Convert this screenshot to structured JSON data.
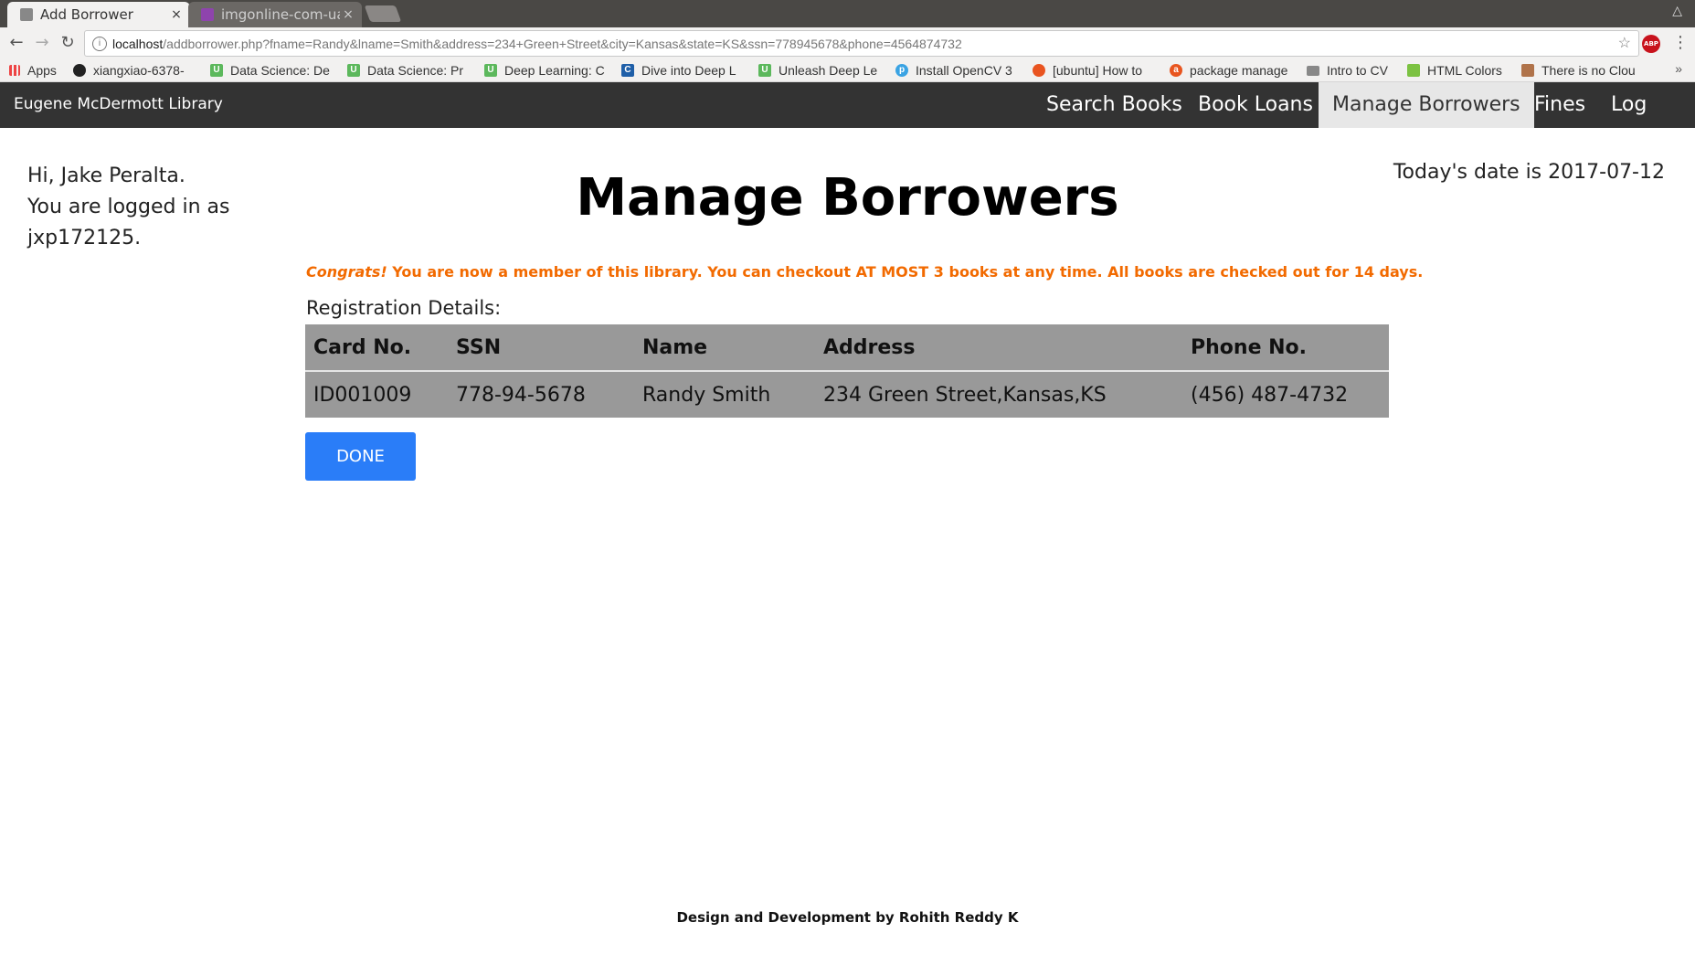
{
  "browser": {
    "tabs": [
      {
        "title": "Add Borrower",
        "close": "×"
      },
      {
        "title": "imgonline-com-ua-",
        "close": "×"
      }
    ],
    "url_host": "localhost",
    "url_path": "/addborrower.php?fname=Randy&lname=Smith&address=234+Green+Street&city=Kansas&state=KS&ssn=778945678&phone=4564874732",
    "bookmarks": [
      {
        "label": "Apps",
        "icon": "apps-grid-icon"
      },
      {
        "label": "xiangxiao-6378-",
        "icon": "github-icon"
      },
      {
        "label": "Data Science: De",
        "icon": "udemy-icon"
      },
      {
        "label": "Data Science: Pr",
        "icon": "udemy-icon"
      },
      {
        "label": "Deep Learning: C",
        "icon": "udemy-icon"
      },
      {
        "label": "Dive into Deep L",
        "icon": "page-icon"
      },
      {
        "label": "Unleash Deep Le",
        "icon": "udemy-icon"
      },
      {
        "label": "Install OpenCV 3",
        "icon": "p-icon"
      },
      {
        "label": "[ubuntu] How to",
        "icon": "ubuntu-icon"
      },
      {
        "label": "package manage",
        "icon": "ask-icon"
      },
      {
        "label": "Intro to CV",
        "icon": "folder-icon"
      },
      {
        "label": "HTML Colors",
        "icon": "colors-icon"
      },
      {
        "label": "There is no Clou",
        "icon": "cloud-icon"
      }
    ],
    "abp_label": "ABP"
  },
  "navbar": {
    "brand": "Eugene McDermott Library",
    "items": [
      "Search Books",
      "Book Loans",
      "Manage Borrowers",
      "Fines",
      "Log out"
    ],
    "active": "Manage Borrowers"
  },
  "greeting": {
    "line1": "Hi, Jake Peralta.",
    "line2": "You are logged in as",
    "line3": "jxp172125."
  },
  "date_text": "Today's date is 2017-07-12",
  "page_title": "Manage Borrowers",
  "notice": {
    "emphasis": "Congrats!",
    "text": " You are now a member of this library. You can checkout AT MOST 3 books at any time. All books are checked out for 14 days."
  },
  "registration_label": "Registration Details:",
  "table": {
    "headers": [
      "Card No.",
      "SSN",
      "Name",
      "Address",
      "Phone No."
    ],
    "row": [
      "ID001009",
      "778-94-5678",
      "Randy Smith",
      "234 Green Street,Kansas,KS",
      "(456) 487-4732"
    ]
  },
  "done_label": "DONE",
  "footer": "Design and Development by Rohith Reddy K",
  "colors": {
    "navbar_bg": "#333333",
    "notice": "#f26a00",
    "table_bg": "#999999",
    "done_button": "#2a7df8"
  }
}
